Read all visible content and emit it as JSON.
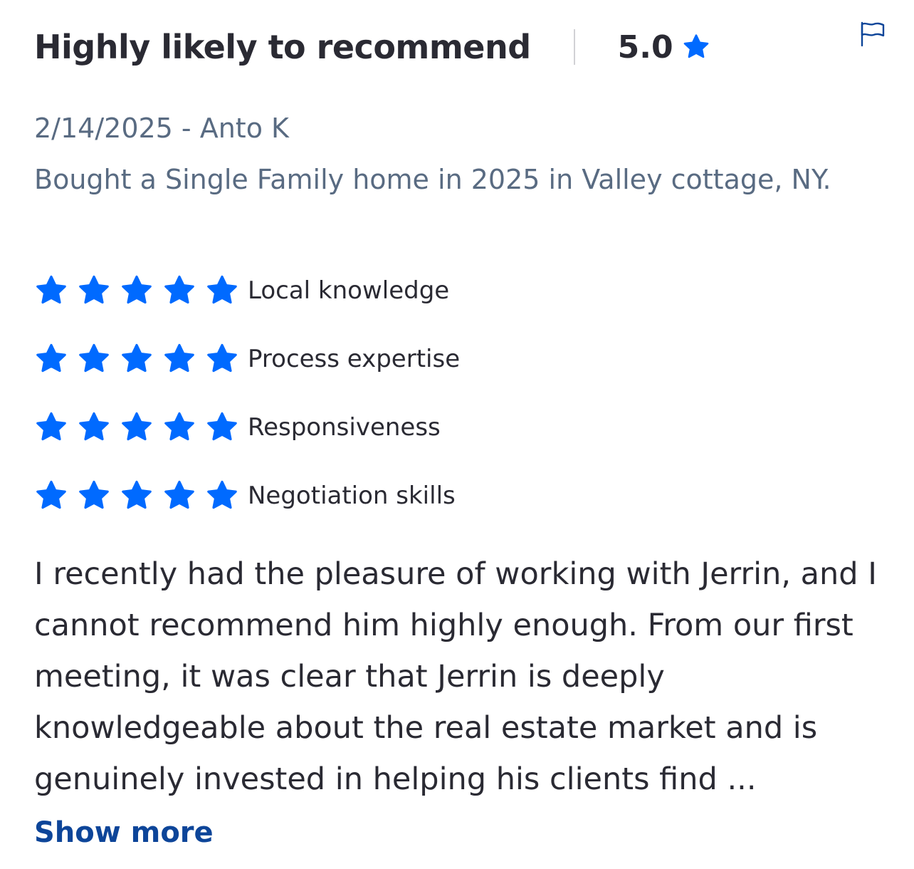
{
  "review": {
    "headline": "Highly likely to recommend",
    "overall_rating": "5.0",
    "meta": "2/14/2025 - Anto K",
    "transaction": "Bought a Single Family home in 2025 in Valley cottage, NY.",
    "sub_ratings": [
      {
        "label": "Local knowledge",
        "stars": 5
      },
      {
        "label": "Process expertise",
        "stars": 5
      },
      {
        "label": "Responsiveness",
        "stars": 5
      },
      {
        "label": "Negotiation skills",
        "stars": 5
      }
    ],
    "body": "I recently had the pleasure of working with Jerrin, and I cannot recommend him highly enough. From our first meeting, it was clear that Jerrin is deeply knowledgeable about the real estate market and is genuinely invested in helping his clients find ...",
    "show_more_label": "Show more"
  },
  "icons": {
    "star": "star-icon",
    "flag": "flag-icon"
  },
  "colors": {
    "star": "#006aff",
    "link": "#0d4599",
    "muted_text": "#596b82",
    "text": "#2a2a33"
  }
}
